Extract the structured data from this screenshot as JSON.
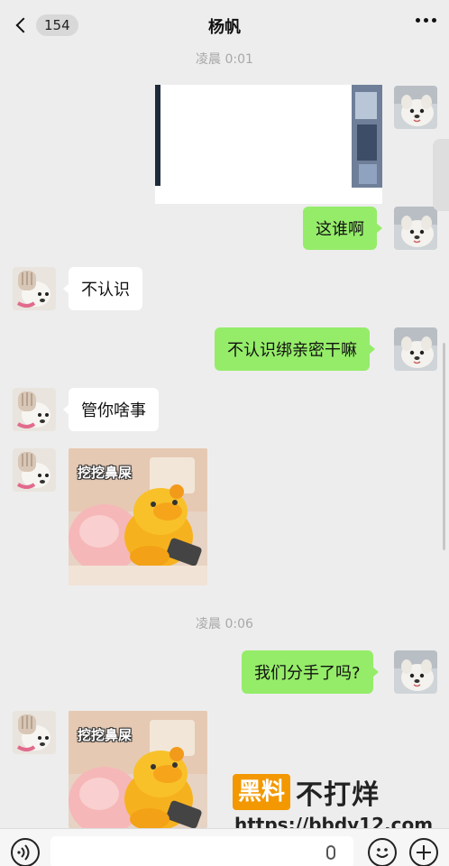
{
  "header": {
    "title": "杨帆",
    "unread_count": "154"
  },
  "messages": [
    {
      "type": "time",
      "text": "凌晨 0:01"
    },
    {
      "type": "image",
      "from": "me"
    },
    {
      "type": "text",
      "from": "me",
      "text": "这谁啊"
    },
    {
      "type": "text",
      "from": "other",
      "text": "不认识"
    },
    {
      "type": "text",
      "from": "me",
      "text": "不认识绑亲密干嘛"
    },
    {
      "type": "text",
      "from": "other",
      "text": "管你啥事"
    },
    {
      "type": "sticker",
      "from": "other",
      "text": "挖挖鼻屎"
    },
    {
      "type": "time",
      "text": "凌晨 0:06"
    },
    {
      "type": "text",
      "from": "me",
      "text": "我们分手了吗?"
    },
    {
      "type": "sticker",
      "from": "other",
      "text": "挖挖鼻屎"
    }
  ],
  "watermark": {
    "brand_box": "黑料",
    "brand_rest": "不打烊",
    "url": "https://bbdy12.com"
  },
  "icons": [
    "back-icon",
    "more-icon",
    "voice-icon",
    "mic-icon",
    "emoji-icon",
    "plus-icon"
  ],
  "colors": {
    "my_bubble": "#95ec69",
    "other_bubble": "#ffffff",
    "background": "#ededed"
  }
}
